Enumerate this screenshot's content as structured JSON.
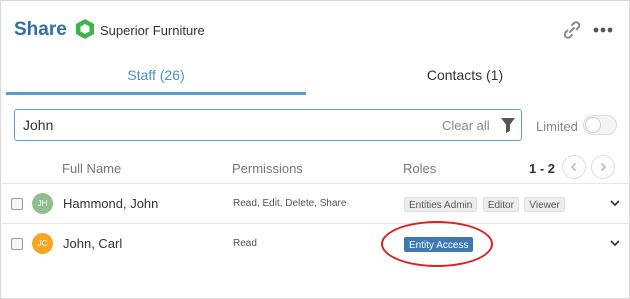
{
  "header": {
    "title": "Share",
    "entity_name": "Superior Furniture",
    "entity_icon": "hexagon-icon",
    "entity_icon_color": "#3cb54a",
    "link_icon": "link-icon",
    "more_icon": "more-icon"
  },
  "tabs": [
    {
      "label": "Staff (26)",
      "active": true
    },
    {
      "label": "Contacts (1)",
      "active": false
    }
  ],
  "search": {
    "value": "John",
    "placeholder": "",
    "clear_label": "Clear all",
    "filter_icon": "filter-icon"
  },
  "limited": {
    "label": "Limited",
    "enabled": false
  },
  "table": {
    "columns": [
      "Full Name",
      "Permissions",
      "Roles"
    ],
    "pager": "1 - 2",
    "rows": [
      {
        "initials": "JH",
        "avatar_color": "#8fbf8f",
        "name": "Hammond, John",
        "permissions": "Read, Edit, Delete, Share",
        "roles": [
          "Entities Admin",
          "Editor",
          "Viewer"
        ]
      },
      {
        "initials": "JC",
        "avatar_color": "#f5a623",
        "name": "John, Carl",
        "permissions": "Read",
        "roles": [
          "Entity Access"
        ]
      }
    ]
  },
  "colors": {
    "accent": "#2f6fa6",
    "tab_underline": "#5b9bd5",
    "annotation": "#e02020"
  }
}
